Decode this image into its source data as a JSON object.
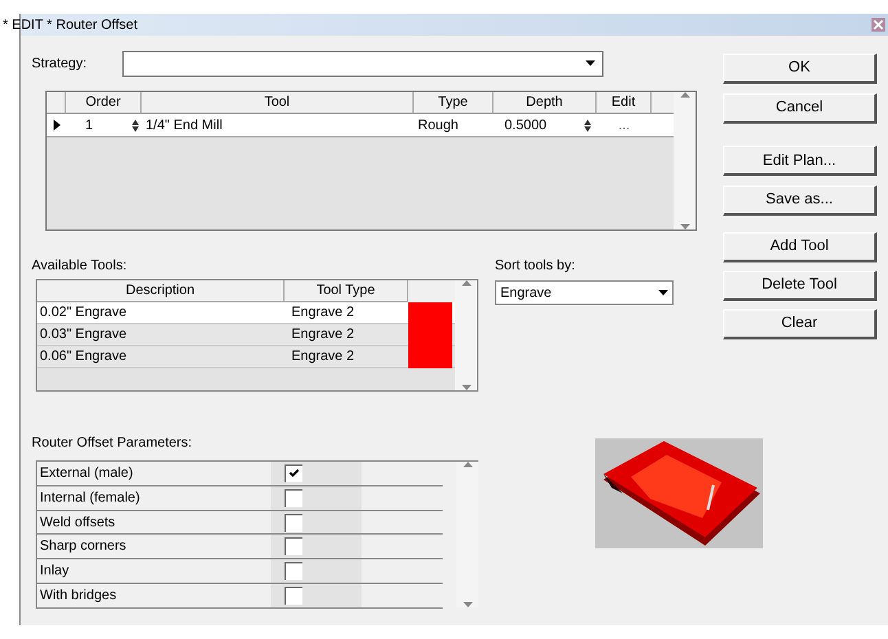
{
  "window": {
    "title": "* EDIT *  Router Offset"
  },
  "strategy": {
    "label": "Strategy:"
  },
  "plan_table": {
    "columns": [
      "Order",
      "Tool",
      "Type",
      "Depth",
      "Edit"
    ],
    "rows": [
      {
        "order": "1",
        "tool": "1/4\" End Mill",
        "type": "Rough",
        "depth": "0.5000",
        "edit": "...",
        "selected": true
      }
    ]
  },
  "buttons_top": [
    "OK",
    "Cancel",
    "Edit Plan...",
    "Save as..."
  ],
  "buttons_tools": [
    "Add Tool",
    "Delete Tool",
    "Clear"
  ],
  "available_tools": {
    "label": "Available Tools:",
    "columns": [
      "Description",
      "Tool Type"
    ],
    "rows": [
      {
        "description": "0.02\" Engrave",
        "tool_type": "Engrave 2",
        "color": "#ff0000",
        "selected": true
      },
      {
        "description": "0.03\" Engrave",
        "tool_type": "Engrave 2",
        "color": "#ff0000",
        "selected": false
      },
      {
        "description": "0.06\" Engrave",
        "tool_type": "Engrave 2",
        "color": "#ff0000",
        "selected": false
      }
    ]
  },
  "sort": {
    "label": "Sort tools by:",
    "value": "Engrave"
  },
  "parameters": {
    "label": "Router Offset Parameters:",
    "rows": [
      {
        "name": "External (male)",
        "checked": true
      },
      {
        "name": "Internal (female)",
        "checked": false
      },
      {
        "name": "Weld offsets",
        "checked": false
      },
      {
        "name": "Sharp corners",
        "checked": false
      },
      {
        "name": "Inlay",
        "checked": false
      },
      {
        "name": "With bridges",
        "checked": false
      }
    ]
  }
}
